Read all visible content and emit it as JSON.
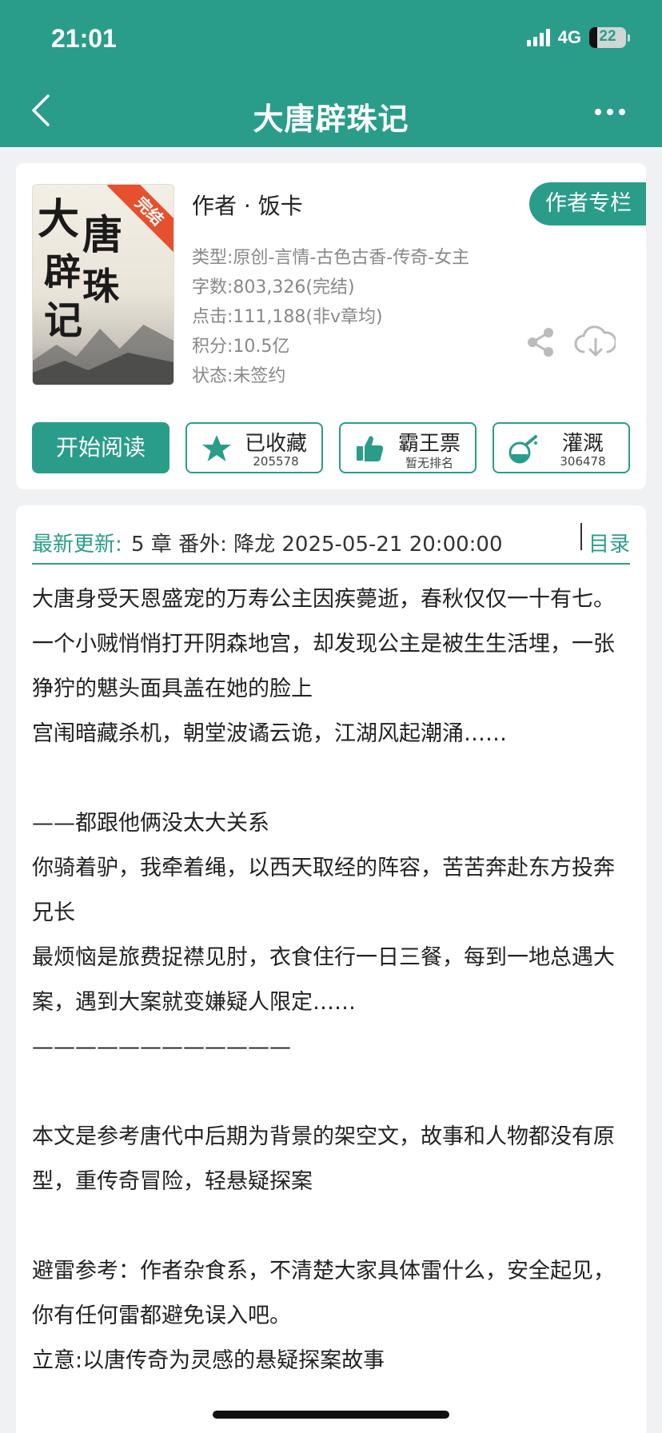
{
  "status_bar": {
    "time": "21:01",
    "network": "4G",
    "battery": "22",
    "battery_level": 0.22
  },
  "header": {
    "title": "大唐辟珠记"
  },
  "book": {
    "cover_title_chars": [
      "大",
      "唐",
      "辟",
      "珠",
      "记"
    ],
    "cover_badge": "完结",
    "author": "作者 · 饭卡",
    "author_column_label": "作者专栏",
    "meta": [
      "类型:原创-言情-古色古香-传奇-女主",
      "字数:803,326(完结)",
      "点击:111,188(非v章均)",
      "积分:10.5亿",
      "状态:未签约"
    ]
  },
  "actions": {
    "read_label": "开始阅读",
    "collect": {
      "label": "已收藏",
      "sub": "205578"
    },
    "ticket": {
      "label": "霸王票",
      "sub": "暂无排名"
    },
    "water": {
      "label": "灌溉",
      "sub": "306478"
    }
  },
  "latest": {
    "label": "最新更新:",
    "text": "5 章 番外: 降龙 2025-05-21 20:00:00",
    "toc_label": "目录"
  },
  "description": [
    "大唐身受天恩盛宠的万寿公主因疾薨逝，春秋仅仅一十有七。",
    "一个小贼悄悄打开阴森地宫，却发现公主是被生生活埋，一张狰狞的魌头面具盖在她的脸上",
    "宫闱暗藏杀机，朝堂波谲云诡，江湖风起潮涌……",
    "",
    "——都跟他俩没太大关系",
    "你骑着驴，我牵着绳，以西天取经的阵容，苦苦奔赴东方投奔兄长",
    "最烦恼是旅费捉襟见肘，衣食住行一日三餐，每到一地总遇大案，遇到大案就变嫌疑人限定……",
    "————————————",
    "",
    "本文是参考唐代中后期为背景的架空文，故事和人物都没有原型，重传奇冒险，轻悬疑探案",
    "",
    "避雷参考：作者杂食系，不清楚大家具体雷什么，安全起见，你有任何雷都避免误入吧。",
    "立意:以唐传奇为灵感的悬疑探案故事"
  ]
}
